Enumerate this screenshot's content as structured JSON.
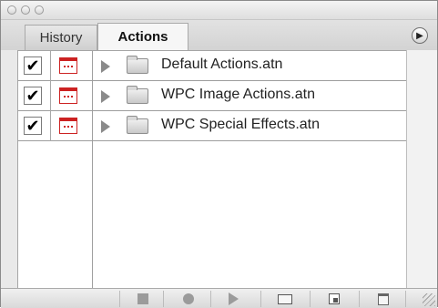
{
  "panel": {
    "tabs": [
      {
        "label": "History",
        "active": false
      },
      {
        "label": "Actions",
        "active": true
      }
    ],
    "actions": [
      {
        "checked": true,
        "dialog": true,
        "label": "Default Actions.atn"
      },
      {
        "checked": true,
        "dialog": true,
        "label": "WPC Image Actions.atn"
      },
      {
        "checked": true,
        "dialog": true,
        "label": "WPC Special Effects.atn"
      }
    ],
    "check_glyph": "✔",
    "menu_glyph": "▶",
    "colors": {
      "accent_red": "#c22222",
      "text": "#222222",
      "panel_bg": "#e9e9e9"
    }
  },
  "bottom_bar": {
    "icons": [
      "stop-icon",
      "record-icon",
      "play-icon",
      "folder-icon",
      "new-action-icon",
      "trash-icon"
    ]
  }
}
